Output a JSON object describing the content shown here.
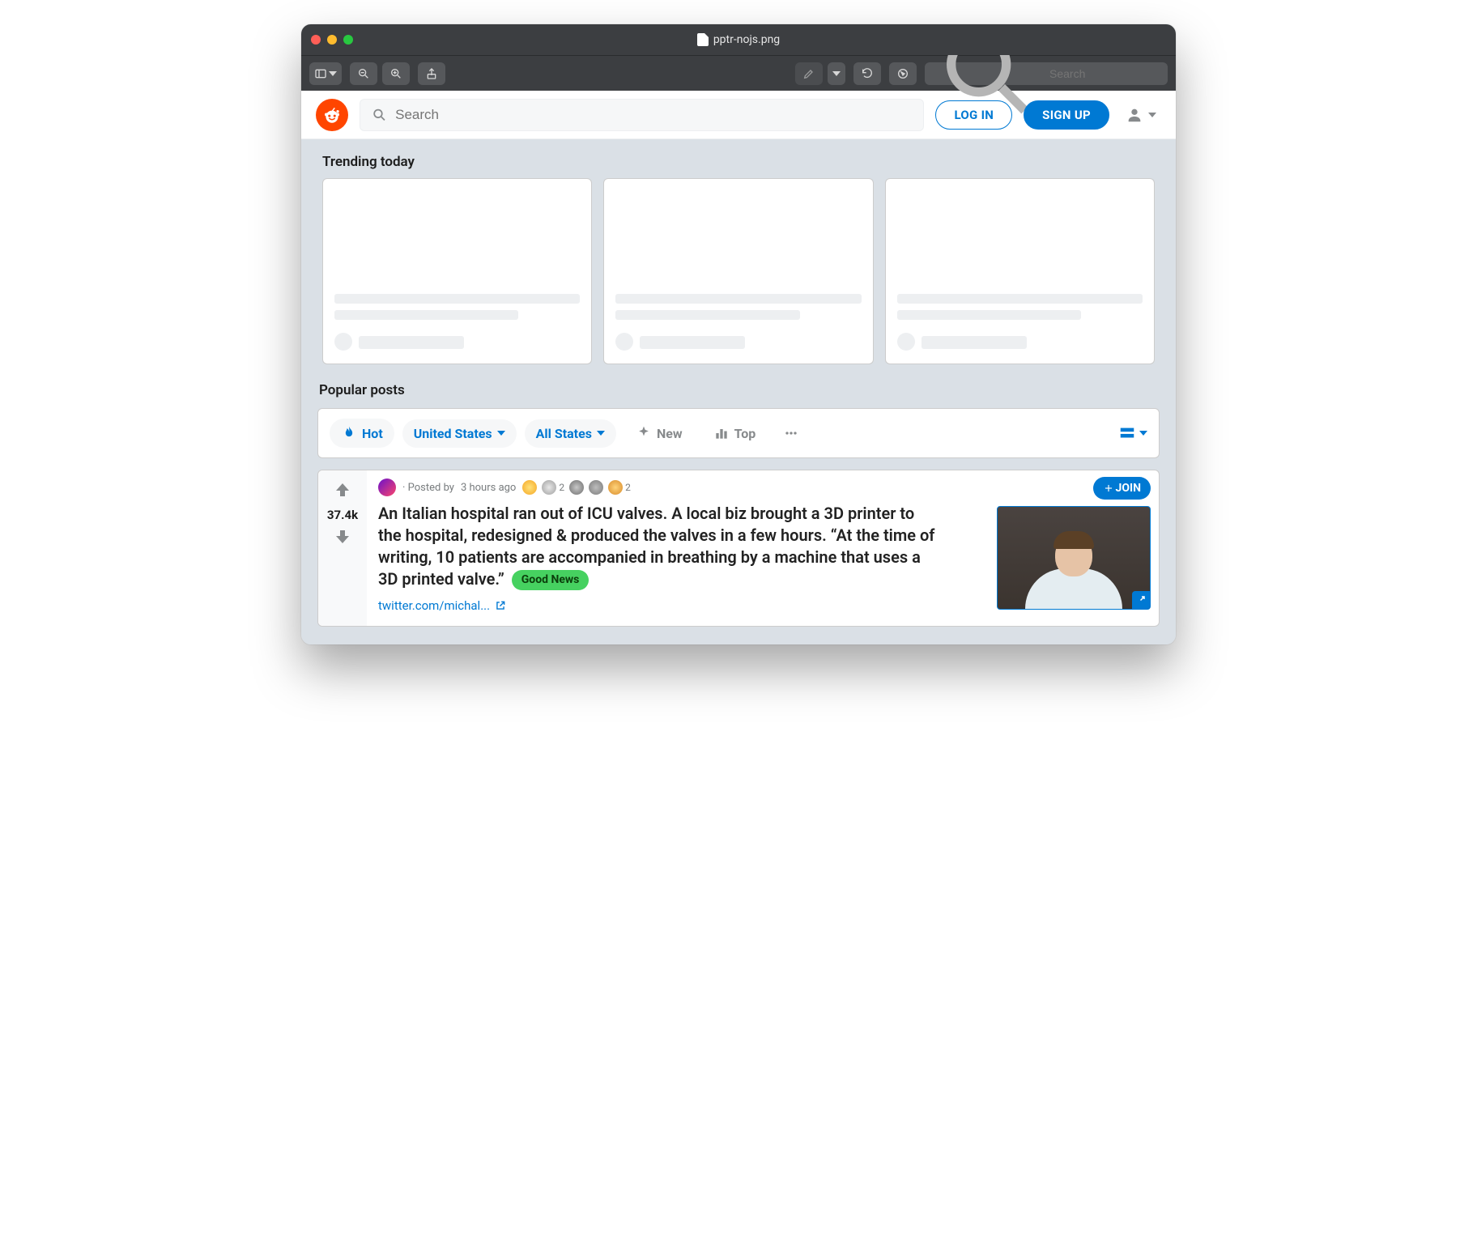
{
  "macos": {
    "title": "pptr-nojs.png",
    "search_placeholder": "Search"
  },
  "header": {
    "search_placeholder": "Search",
    "login_label": "LOG IN",
    "signup_label": "SIGN UP"
  },
  "sections": {
    "trending_label": "Trending today",
    "popular_label": "Popular posts"
  },
  "filters": {
    "hot": "Hot",
    "country": "United States",
    "region": "All States",
    "new": "New",
    "top": "Top"
  },
  "post": {
    "score": "37.4k",
    "posted_by_prefix": "· Posted by",
    "age": "3 hours ago",
    "award_counts": [
      "2",
      "2"
    ],
    "join_label": "JOIN",
    "title": "An Italian hospital ran out of ICU valves. A local biz brought a 3D printer to the hospital, redesigned & produced the valves in a few hours. “At the time of writing, 10 patients are accompanied in breathing by a machine that uses a 3D printed valve.”",
    "tag": "Good News",
    "link_text": "twitter.com/michal..."
  }
}
